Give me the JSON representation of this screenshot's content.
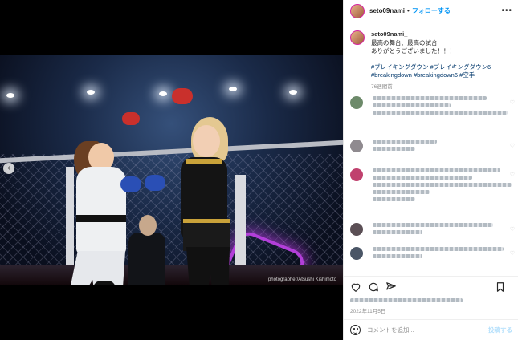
{
  "photo": {
    "credit": "photographer/Atsushi Kishimoto"
  },
  "header": {
    "username": "seto09nami",
    "separator": "•",
    "follow_label": "フォローする",
    "more_label": "•••"
  },
  "caption": {
    "username": "seto09nami_",
    "lines": [
      "最高の舞台、最高の試合",
      "ありがとうございました！！！"
    ],
    "tags_line1": "#ブレイキングダウン #ブレイキングダウン6",
    "tags_line2": "#breakingdown #breakingdown6 #空手",
    "time": "76週間前"
  },
  "actions": {
    "date": "2022年11月5日"
  },
  "add_comment": {
    "placeholder": "コメントを追加...",
    "post_label": "投稿する"
  },
  "colors": {
    "accent": "#0095f6",
    "tag": "#00376b",
    "muted": "#8e8e8e"
  }
}
